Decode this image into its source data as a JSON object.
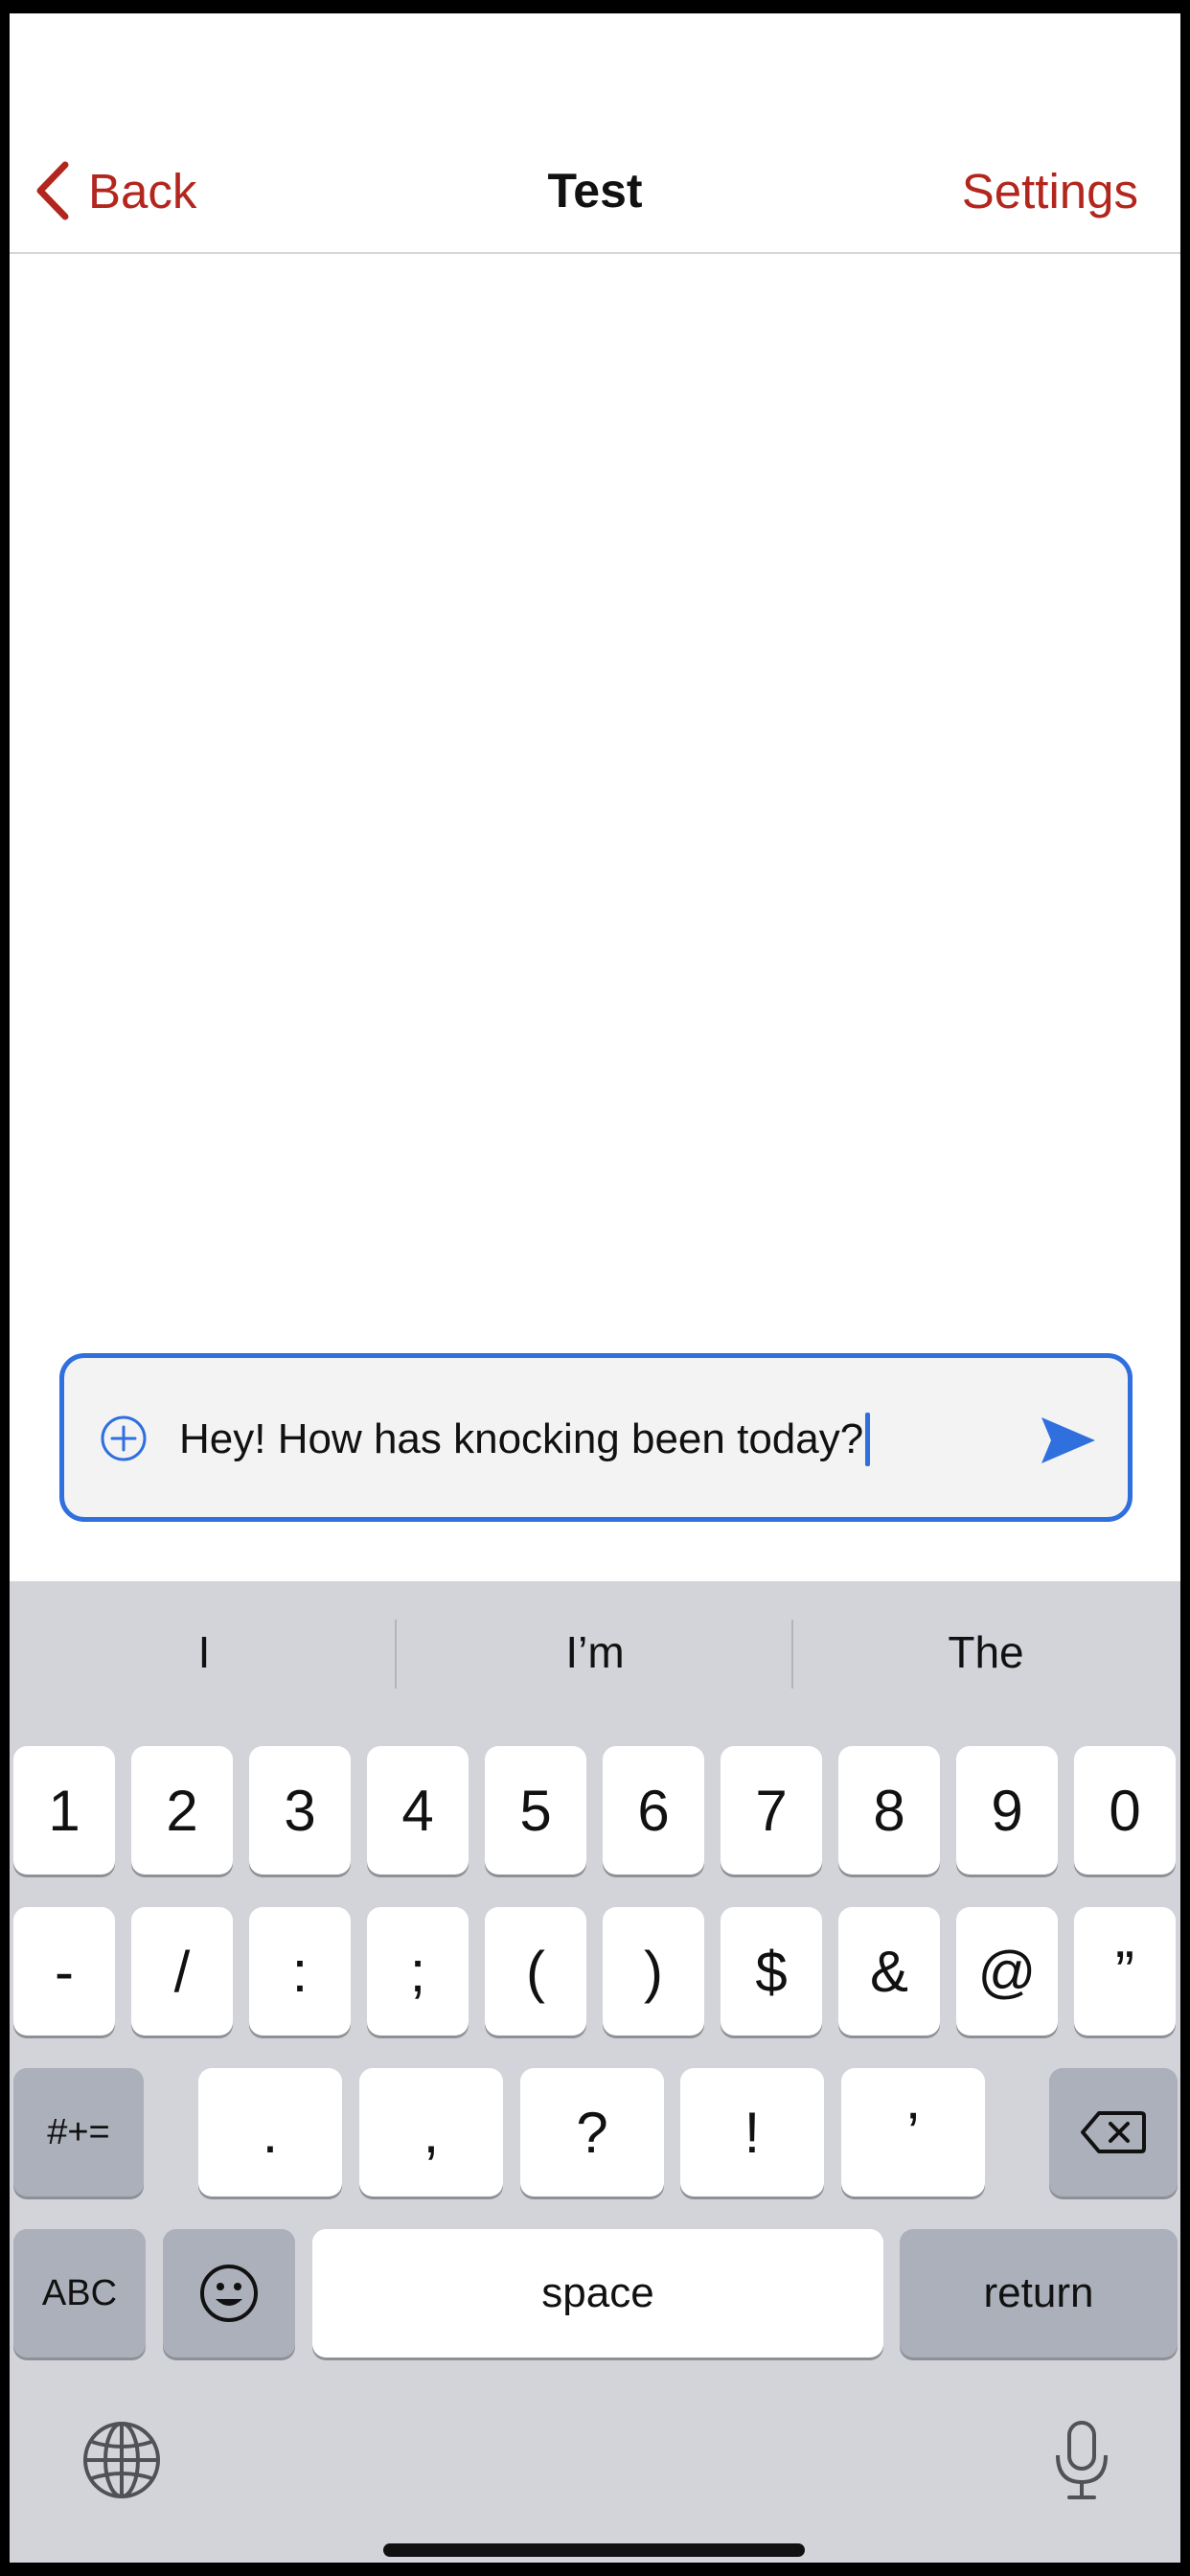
{
  "nav": {
    "back_label": "Back",
    "title": "Test",
    "settings_label": "Settings"
  },
  "composer": {
    "value": "Hey! How has knocking been today?",
    "accent": "#2f6fde"
  },
  "keyboard": {
    "suggestions": [
      "I",
      "I’m",
      "The"
    ],
    "row1": [
      "1",
      "2",
      "3",
      "4",
      "5",
      "6",
      "7",
      "8",
      "9",
      "0"
    ],
    "row2": [
      "-",
      "/",
      ":",
      ";",
      "(",
      ")",
      "$",
      "&",
      "@",
      "”"
    ],
    "row3": {
      "mode_key": "#+=",
      "keys": [
        ".",
        ",",
        "?",
        "!",
        "’"
      ]
    },
    "row4": {
      "abc_key": "ABC",
      "space_key": "space",
      "return_key": "return"
    }
  },
  "colors": {
    "nav_accent": "#b3261e",
    "composer_accent": "#2f6fde"
  }
}
